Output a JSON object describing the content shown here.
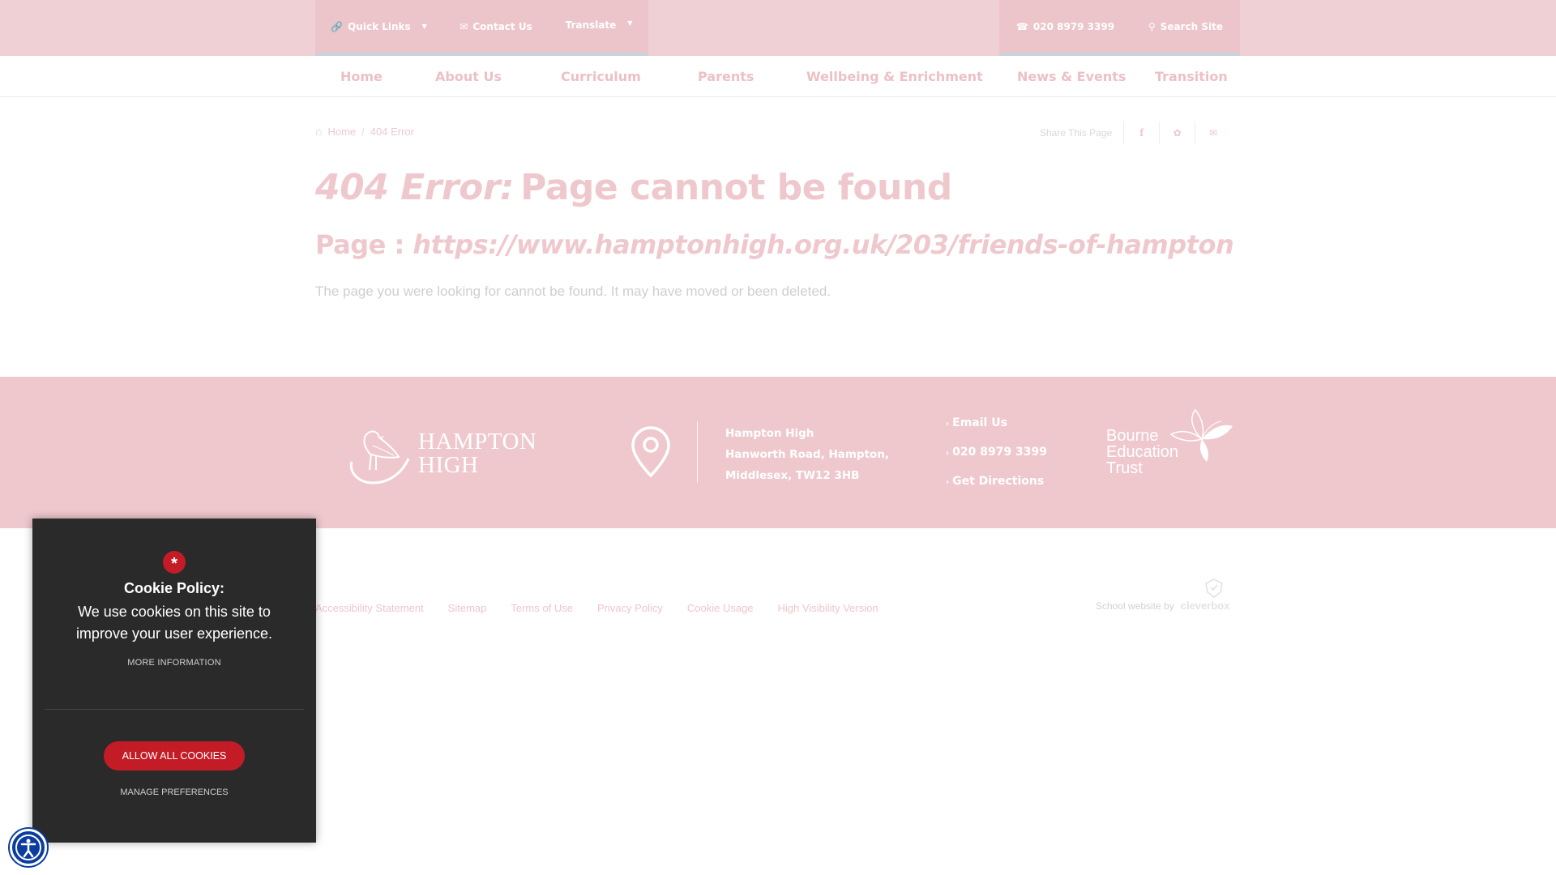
{
  "topbar": {
    "quick_links": "Quick Links",
    "contact": "Contact Us",
    "translate": "Translate",
    "phone": "020 8979 3399",
    "search": "Search Site"
  },
  "nav": {
    "items": [
      "Home",
      "About Us",
      "Curriculum",
      "Parents",
      "Wellbeing & Enrichment",
      "News & Events",
      "Transition"
    ]
  },
  "breadcrumb": {
    "home": "Home",
    "sep": "/",
    "current": "404 Error"
  },
  "share": {
    "label": "Share This Page"
  },
  "error": {
    "code": "404 Error:",
    "title": "Page cannot be found",
    "page_label": "Page :",
    "url": "https://www.hamptonhigh.org.uk/203/friends-of-hampton",
    "message": "The page you were looking for cannot be found. It may have moved or been deleted."
  },
  "footer": {
    "logo_line1": "HAMPTON",
    "logo_line2": "HIGH",
    "address": [
      "Hampton High",
      "Hanworth Road, Hampton,",
      "Middlesex, TW12 3HB"
    ],
    "links": [
      "Email Us",
      "020 8979 3399",
      "Get Directions"
    ],
    "trust_line1": "Bourne",
    "trust_line2": "Education",
    "trust_line3": "Trust"
  },
  "bottom": {
    "links": [
      "Accessibility Statement",
      "Sitemap",
      "Terms of Use",
      "Privacy Policy",
      "Cookie Usage",
      "High Visibility Version"
    ],
    "credit_label": "School website by",
    "credit_brand": "cleverbox"
  },
  "cookie": {
    "badge": "*",
    "title": "Cookie Policy:",
    "description": "We use cookies on this site to improve your user experience.",
    "more": "MORE INFORMATION",
    "allow": "ALLOW ALL COOKIES",
    "manage": "MANAGE PREFERENCES"
  },
  "colors": {
    "brand_pink": "#efc8cd",
    "cookie_bg": "#2a2a2a",
    "cookie_accent": "#c41c27",
    "a11y_blue": "#0a3d9e"
  },
  "icons": [
    "link-icon",
    "envelope-icon",
    "caret-down-icon",
    "phone-icon",
    "search-icon",
    "home-icon",
    "facebook-icon",
    "twitter-icon",
    "email-share-icon",
    "map-pin-icon",
    "chevron-right-icon",
    "accessibility-icon"
  ]
}
